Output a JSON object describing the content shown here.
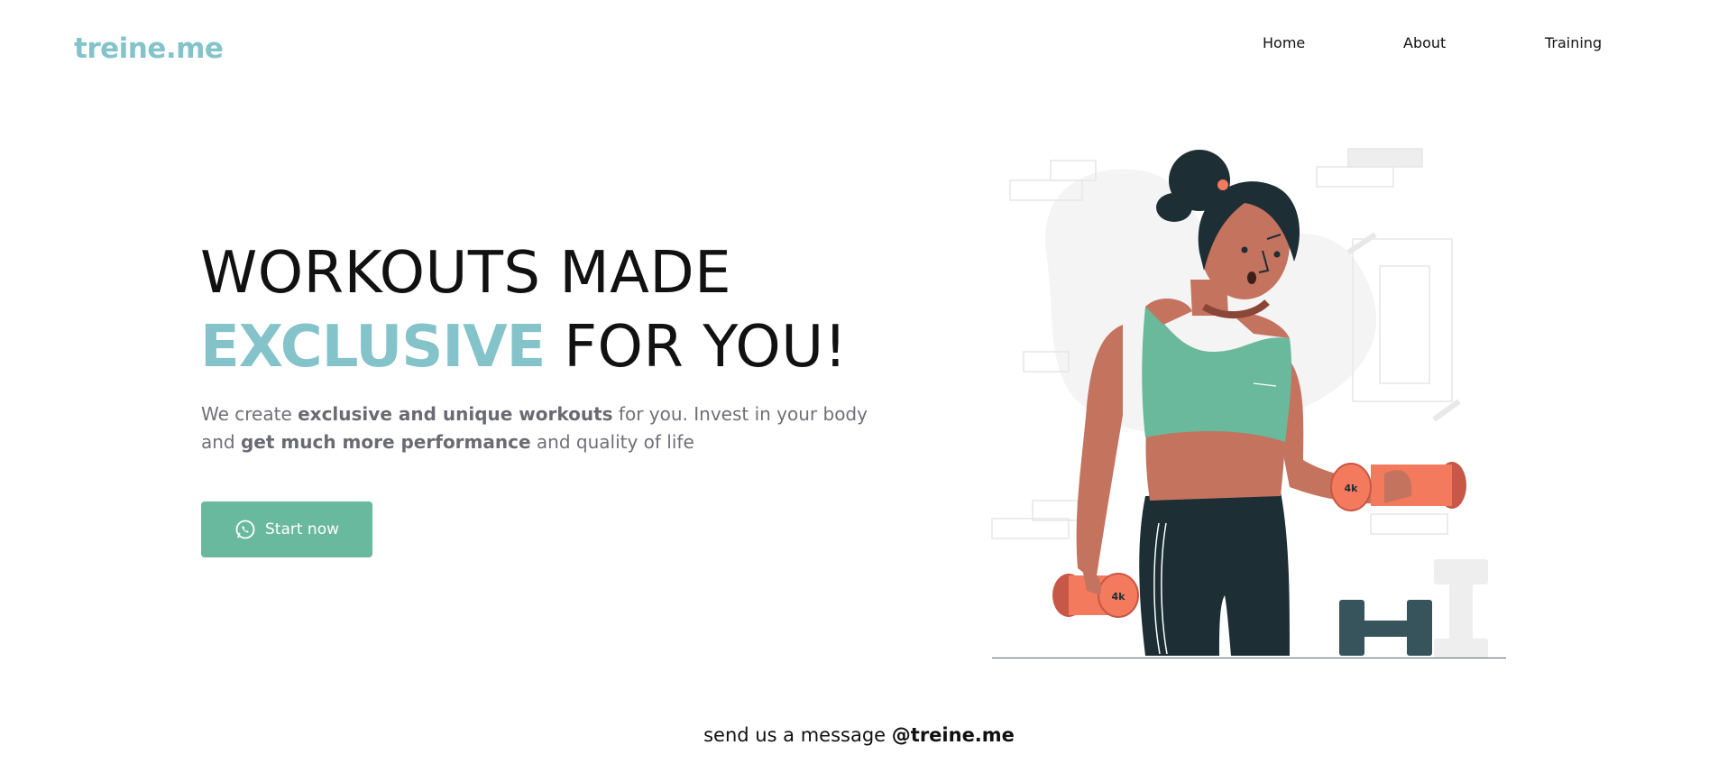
{
  "header": {
    "logo": "treine.me",
    "nav": [
      {
        "label": "Home"
      },
      {
        "label": "About"
      },
      {
        "label": "Training"
      }
    ]
  },
  "hero": {
    "title_line1": "WORKOUTS MADE",
    "title_accent": "EXCLUSIVE",
    "title_rest": " FOR YOU!",
    "desc": {
      "t1": "We create ",
      "b1": "exclusive and unique workouts",
      "t2": " for you. Invest in your body and ",
      "b2": "get much more performance",
      "t3": " and quality of life"
    },
    "cta": {
      "label": "Start now",
      "icon": "whatsapp-icon"
    },
    "illustration": {
      "dumbbell_label": "4k"
    }
  },
  "footer": {
    "text": "send us a message ",
    "handle": "@treine.me"
  },
  "colors": {
    "accent": "#85c3cb",
    "button": "#69b99e",
    "text_muted": "#6f6f78",
    "dumbbell": "#f47a5d",
    "skin": "#c4735f",
    "hair": "#1d2e35",
    "top": "#6bb99c"
  }
}
